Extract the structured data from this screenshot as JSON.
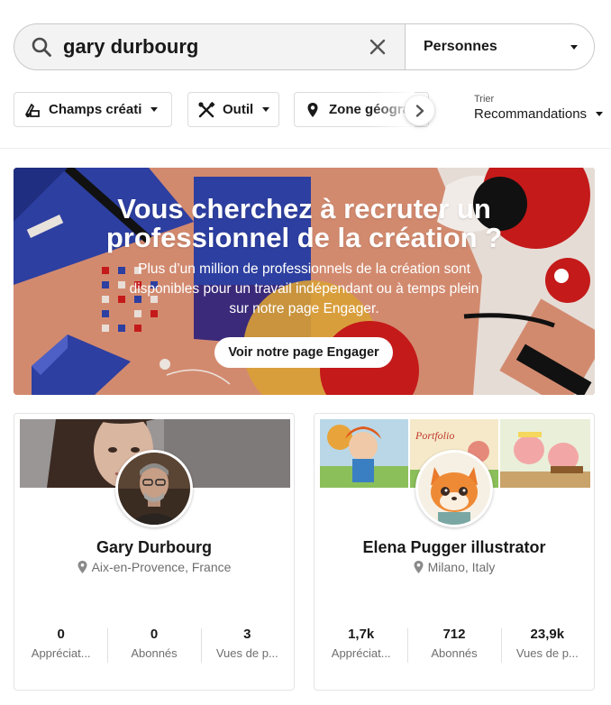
{
  "search": {
    "query": "gary durbourg",
    "type_label": "Personnes"
  },
  "filters": [
    {
      "label": "Champs créati",
      "icon": "creative-fields-icon"
    },
    {
      "label": "Outils",
      "icon": "tools-icon"
    },
    {
      "label": "Zone géograp",
      "icon": "location-pin-icon"
    }
  ],
  "sort": {
    "label": "Trier",
    "value": "Recommandations"
  },
  "banner": {
    "title": "Vous cherchez à recruter un professionnel de la création ?",
    "text": "Plus d’un million de professionnels de la création sont disponibles pour un travail indépendant ou à temps plein sur notre page Engager.",
    "button_label": "Voir notre page Engager"
  },
  "cards": [
    {
      "name": "Gary Durbourg",
      "location": "Aix-en-Provence, France",
      "stats": [
        {
          "value": "0",
          "label": "Appréciat..."
        },
        {
          "value": "0",
          "label": "Abonnés"
        },
        {
          "value": "3",
          "label": "Vues de p..."
        }
      ]
    },
    {
      "name": "Elena Pugger illustrator",
      "location": "Milano, Italy",
      "cover_text": "Portfolio",
      "stats": [
        {
          "value": "1,7k",
          "label": "Appréciat..."
        },
        {
          "value": "712",
          "label": "Abonnés"
        },
        {
          "value": "23,9k",
          "label": "Vues de p..."
        }
      ]
    }
  ],
  "colors": {
    "banner_bg": "#d28a6f",
    "banner_blue": "#2d3fa0",
    "banner_red": "#c41a1a",
    "muted_text": "#6e6e6e"
  }
}
